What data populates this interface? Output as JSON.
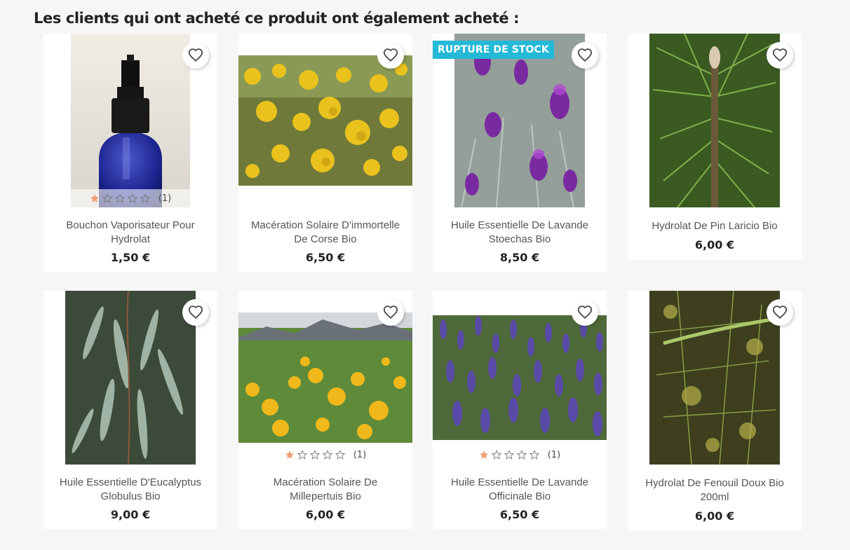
{
  "section": {
    "title": "Les clients qui ont acheté ce produit ont également acheté :"
  },
  "colors": {
    "background": "#f6f6f6",
    "card": "#ffffff",
    "flag": "#24b9d7",
    "star_filled": "#f39d72",
    "star_empty": "#7a7a7a",
    "price_text": "#232323",
    "name_text": "#555555"
  },
  "icons": {
    "wishlist": "heart-outline-icon",
    "star": "star-icon"
  },
  "products": [
    {
      "name": "Bouchon Vaporisateur Pour Hydrolat",
      "price": "1,50 €",
      "image": "blue-glass-spray-bottle",
      "flag": null,
      "rating": {
        "stars": 1,
        "max": 5,
        "count": "(1)"
      }
    },
    {
      "name": "Macération Solaire D'immortelle De Corse Bio",
      "price": "6,50 €",
      "image": "yellow-immortelle-flowers",
      "flag": null,
      "rating": null
    },
    {
      "name": "Huile Essentielle De Lavande Stoechas Bio",
      "price": "8,50 €",
      "image": "purple-stoechas-lavender",
      "flag": "RUPTURE DE STOCK",
      "rating": null
    },
    {
      "name": "Hydrolat De Pin Laricio Bio",
      "price": "6,00 €",
      "image": "pine-branch",
      "flag": null,
      "rating": null
    },
    {
      "name": "Huile Essentielle D'Eucalyptus Globulus Bio",
      "price": "9,00 €",
      "image": "eucalyptus-leaves",
      "flag": null,
      "rating": null
    },
    {
      "name": "Macération Solaire De Millepertuis Bio",
      "price": "6,00 €",
      "image": "yellow-st-johns-wort-field",
      "flag": null,
      "rating": {
        "stars": 1,
        "max": 5,
        "count": "(1)"
      }
    },
    {
      "name": "Huile Essentielle De Lavande Officinale Bio",
      "price": "6,50 €",
      "image": "lavender-field",
      "flag": null,
      "rating": {
        "stars": 1,
        "max": 5,
        "count": "(1)"
      }
    },
    {
      "name": "Hydrolat De Fenouil Doux Bio 200ml",
      "price": "6,00 €",
      "image": "fennel-plant",
      "flag": null,
      "rating": null
    }
  ]
}
